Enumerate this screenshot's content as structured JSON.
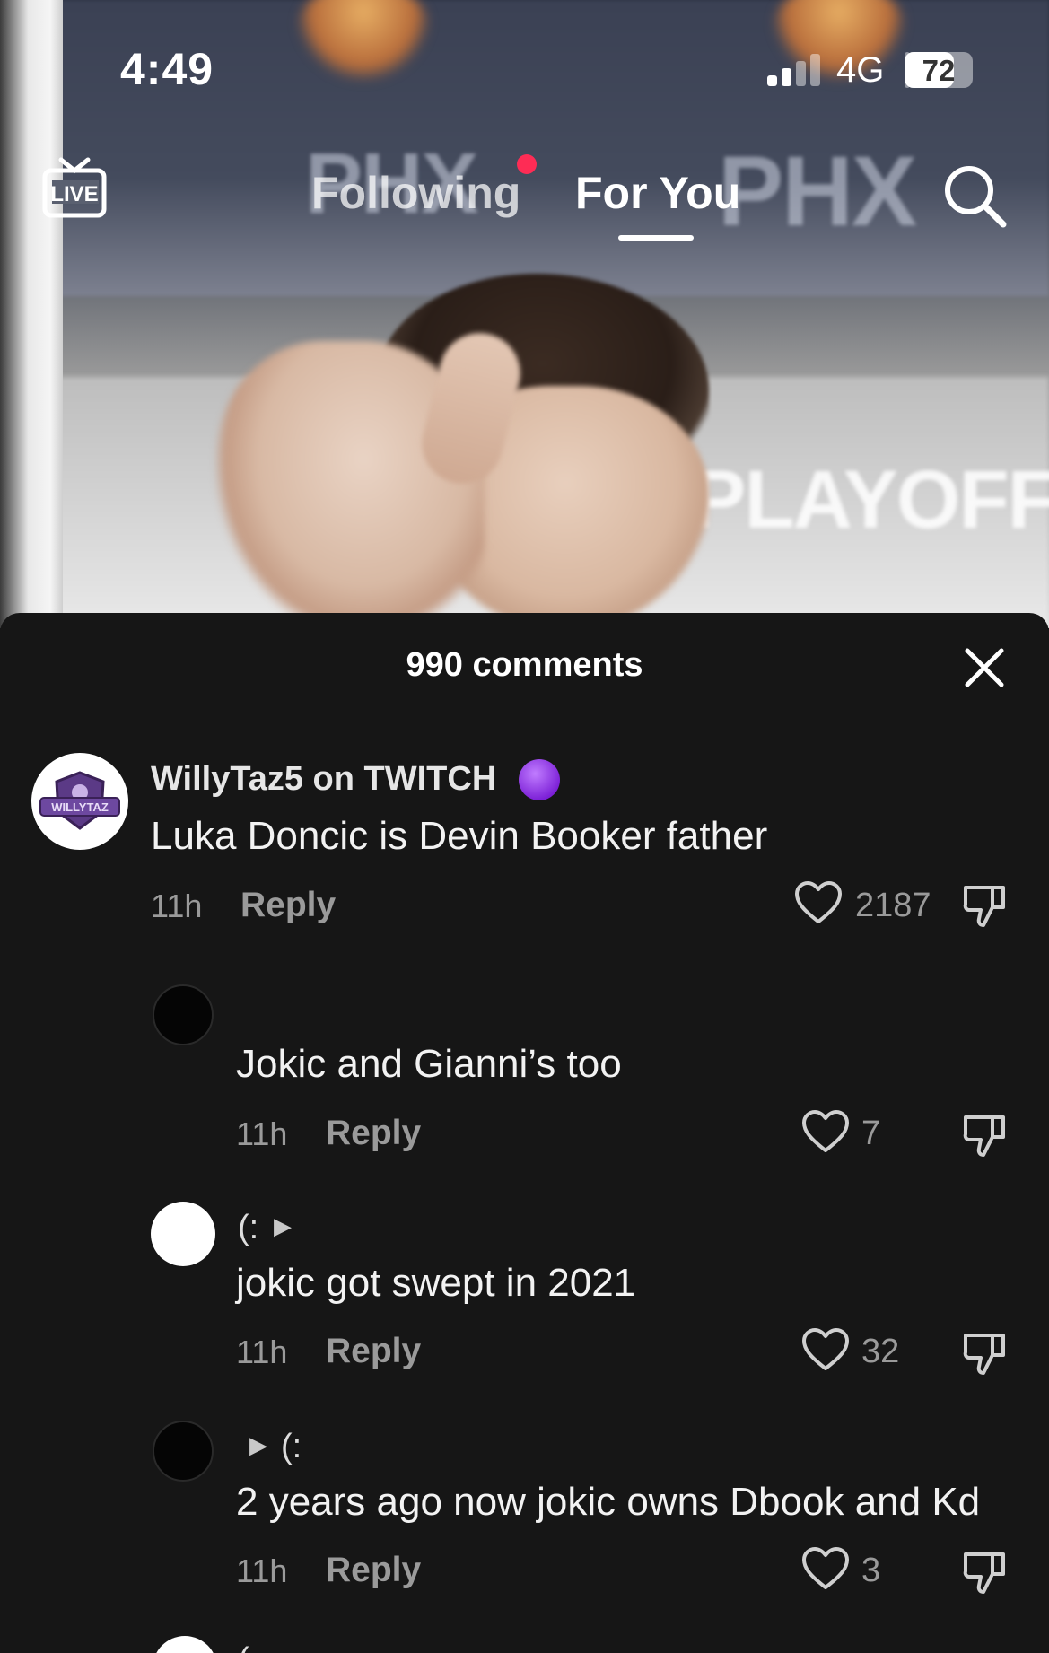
{
  "status_bar": {
    "time": "4:49",
    "network": "4G",
    "battery": "72",
    "battery_level": 0.72,
    "signal_bars_active": 2,
    "signal_bars_total": 4
  },
  "video": {
    "background_text_1": "PHX",
    "background_text_2": "PLAYOFF"
  },
  "top_nav": {
    "live_icon": "live-tv-icon",
    "tabs": [
      {
        "label": "Following",
        "active": false,
        "has_dot": true
      },
      {
        "label": "For You",
        "active": true
      }
    ],
    "search_icon": "search-icon"
  },
  "comments_sheet": {
    "title": "990 comments",
    "close_icon": "close-icon",
    "comments": [
      {
        "author": "WillyTaz5 on TWITCH",
        "author_badge": "purple-circle-emoji",
        "avatar_text": "WILLYTAZ",
        "text": "Luka Doncic is Devin Booker father",
        "time": "11h",
        "reply_label": "Reply",
        "likes": "2187"
      }
    ],
    "replies": [
      {
        "author": "",
        "text": "Jokic and Gianni’s too",
        "time": "11h",
        "reply_label": "Reply",
        "likes": "7"
      },
      {
        "author": "(:",
        "text": "jokic got swept in 2021",
        "time": "11h",
        "reply_label": "Reply",
        "likes": "32"
      },
      {
        "author": "(:",
        "text": "2 years ago now jokic owns Dbook and Kd",
        "time": "11h",
        "reply_label": "Reply",
        "likes": "3"
      }
    ],
    "partial_next_reply": {
      "author": "("
    }
  },
  "colors": {
    "sheet_bg": "#161616",
    "accent_dot": "#fe2c55",
    "badge_purple": "#8a2be2",
    "muted_text": "#9a9a9a"
  }
}
